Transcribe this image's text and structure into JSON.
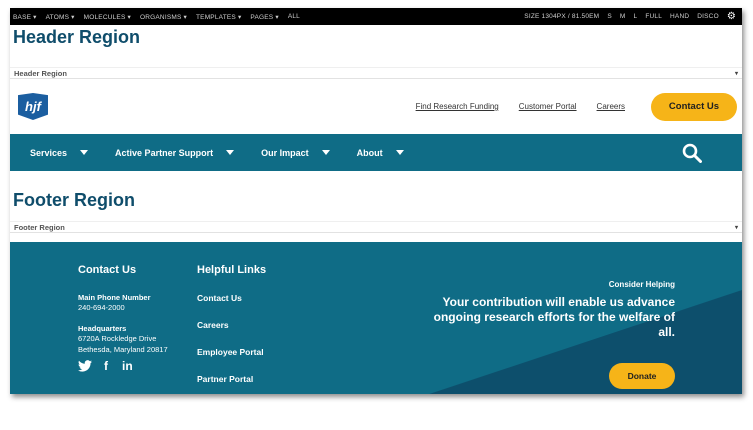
{
  "toolbar": {
    "left": [
      "BASE ▾",
      "ATOMS ▾",
      "MOLECULES ▾",
      "ORGANISMS ▾",
      "TEMPLATES ▾",
      "PAGES ▾",
      "ALL"
    ],
    "size_label": "SIZE 1304PX / 81.50EM",
    "right": [
      "S",
      "M",
      "L",
      "FULL",
      "HAND",
      "DISCO"
    ],
    "gear": "⚙"
  },
  "header_region": {
    "title": "Header Region",
    "bar_label": "Header Region",
    "arrow": "▾"
  },
  "site_header": {
    "logo_text": "hjf",
    "links": [
      "Find Research Funding",
      "Customer Portal",
      "Careers"
    ],
    "contact_label": "Contact Us"
  },
  "main_nav": {
    "items": [
      "Services",
      "Active Partner Support",
      "Our Impact",
      "About"
    ]
  },
  "footer_region": {
    "title": "Footer Region",
    "bar_label": "Footer Region",
    "arrow": "▾"
  },
  "footer": {
    "contact_heading": "Contact Us",
    "phone_label": "Main Phone Number",
    "phone": "240-694-2000",
    "hq_label": "Headquarters",
    "address_line1": "6720A Rockledge Drive",
    "address_line2": "Bethesda, Maryland 20817",
    "social": [
      "twitter-icon",
      "facebook-icon",
      "linkedin-icon"
    ],
    "links_heading": "Helpful Links",
    "links": [
      "Contact Us",
      "Careers",
      "Employee Portal",
      "Partner Portal"
    ],
    "help_caption": "Consider Helping",
    "help_message": "Your contribution will enable us advance ongoing research efforts for the welfare of all.",
    "donate_label": "Donate"
  },
  "colors": {
    "brand_teal": "#0f6c86",
    "accent_yellow": "#f6b418",
    "heading_blue": "#0f4d6b"
  }
}
